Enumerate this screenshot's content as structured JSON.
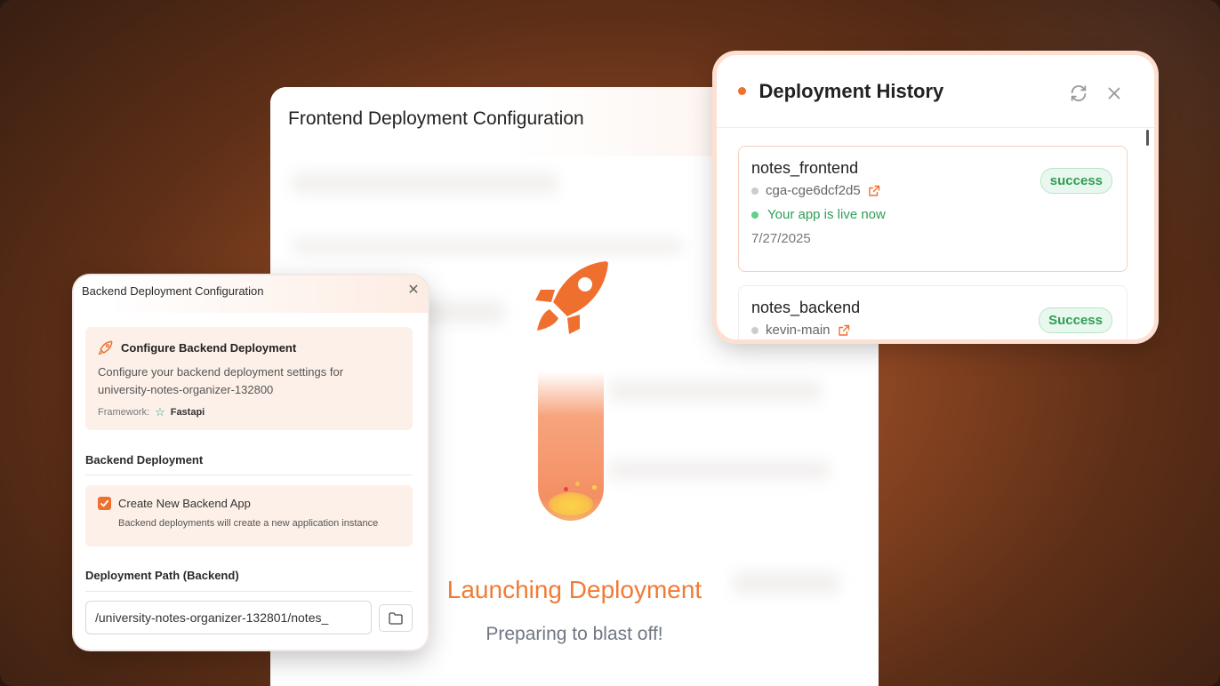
{
  "frontend": {
    "title": "Frontend Deployment Configuration",
    "launch_title": "Launching Deployment",
    "launch_subtitle": "Preparing to blast off!"
  },
  "backend": {
    "title": "Backend Deployment Configuration",
    "configure_heading": "Configure Backend Deployment",
    "configure_text_line1": "Configure your backend deployment settings for",
    "configure_text_line2": "university-notes-organizer-132800",
    "framework_label": "Framework:",
    "framework_value": "Fastapi",
    "section_deployment": "Backend Deployment",
    "create_label": "Create New Backend App",
    "create_checked": true,
    "create_sub": "Backend deployments will create a new application instance",
    "path_label": "Deployment Path (Backend)",
    "path_value": "/university-notes-organizer-132801/notes_"
  },
  "history": {
    "title": "Deployment History",
    "items": [
      {
        "name": "notes_frontend",
        "id": "cga-cge6dcf2d5",
        "status_text": "Your app is live now",
        "date": "7/27/2025",
        "badge": "success"
      },
      {
        "name": "notes_backend",
        "id": "kevin-main",
        "badge": "Success"
      }
    ]
  },
  "colors": {
    "accent": "#ef6f2f",
    "success": "#2f9e55"
  }
}
